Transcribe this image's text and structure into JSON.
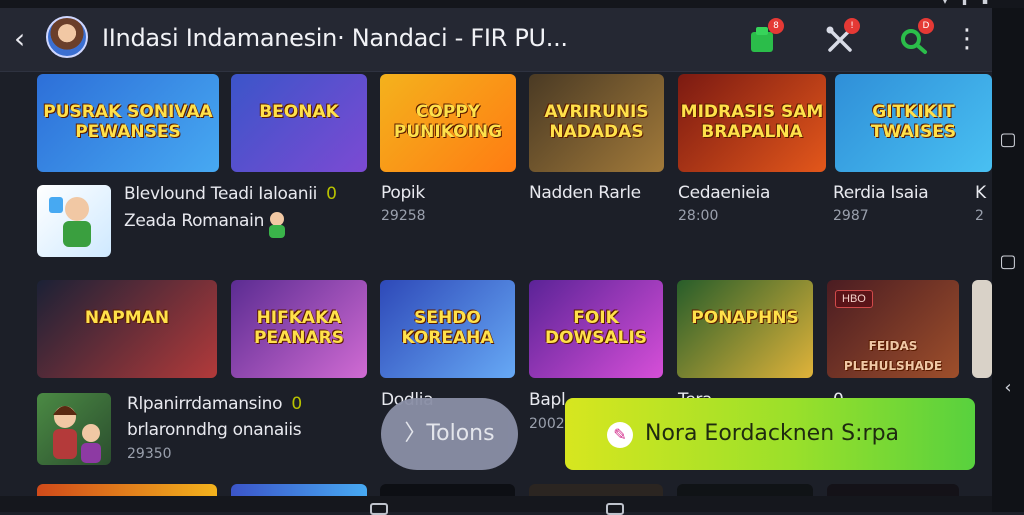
{
  "app": {
    "title": "IIndasi  Indamanesin· Nandaci - FIR PU...",
    "back_icon": "back-arrow-icon",
    "actions": [
      {
        "icon": "gift-icon",
        "badge": "8",
        "color": "#2bbd4a"
      },
      {
        "icon": "crossed-tools-icon",
        "badge": "!",
        "color": "#d8dbe6"
      },
      {
        "icon": "search-icon",
        "badge": "D",
        "color": "#2bbd4a"
      }
    ],
    "more_icon": "more-vertical-icon"
  },
  "row1": {
    "banners": [
      {
        "art_text": "PUSRAK SONIVAA PEWANSES",
        "colors": [
          "#2d6fd8",
          "#47a9f2"
        ]
      },
      {
        "art_text": "BEONAK",
        "colors": [
          "#3b55c9",
          "#7c4ad3"
        ]
      },
      {
        "art_text": "COPPY PUNIKOING",
        "colors": [
          "#f4b21d",
          "#ff7c12"
        ]
      },
      {
        "art_text": "AVRIRUNIS NADADAS",
        "colors": [
          "#4a3a24",
          "#a27a3a"
        ]
      },
      {
        "art_text": "MIDRASIS SAM BRAPALNA",
        "colors": [
          "#7b1a12",
          "#e3571b"
        ]
      },
      {
        "art_text": "GITKIKIT TWAISES",
        "colors": [
          "#2f8fd8",
          "#49c0f2"
        ]
      }
    ],
    "featured": {
      "title": "Blevlound Teadi Ialoanii",
      "marker": "0",
      "subtitle": "Zeada Romanain"
    },
    "tiles": [
      {
        "title": "Popik",
        "sub": "29258"
      },
      {
        "title": "Nadden Rarle",
        "sub": ""
      },
      {
        "title": "Cedaenieia",
        "sub": "28:00"
      },
      {
        "title": "Rerdia Isaia",
        "sub": "2987"
      },
      {
        "title": "K",
        "sub": "2"
      }
    ]
  },
  "row2": {
    "banners": [
      {
        "art_text": "NAPMAN",
        "colors": [
          "#1b2136",
          "#b23a3a"
        ]
      },
      {
        "art_text": "HIFKAKA PEANARS",
        "colors": [
          "#5b2c92",
          "#d06bd3"
        ]
      },
      {
        "art_text": "SEHDO KOREAHA",
        "colors": [
          "#2e49b8",
          "#67a9f5"
        ]
      },
      {
        "art_text": "FOIK DOWSALIS",
        "colors": [
          "#5b2397",
          "#d64fd8"
        ]
      },
      {
        "art_text": "PONAPHNS",
        "colors": [
          "#275d2a",
          "#e0b33a"
        ]
      },
      {
        "art_text": "FEIDAS PLEHULSHADE",
        "badge": "HBO",
        "colors": [
          "#4a1c22",
          "#9e4f2b"
        ]
      }
    ],
    "featured": {
      "title": "Rlpanirrdamansino",
      "marker": "0",
      "subtitle": "brlaronndhg onanaiis",
      "sub2": "29350"
    },
    "tiles": [
      {
        "title": "Dodlia",
        "sub": ""
      },
      {
        "title": "Bapl",
        "sub": "2002"
      },
      {
        "title": "Tera..",
        "sub": ""
      },
      {
        "title": "0",
        "sub": ""
      }
    ]
  },
  "buttons": {
    "tokens": "〉Tolons",
    "cta": "Nora Eordacknen S:rpa",
    "cta_icon": "ticket-icon"
  },
  "system_nav": {
    "items": [
      "recents-square-icon",
      "home-square-icon",
      "back-triangle-icon"
    ]
  }
}
